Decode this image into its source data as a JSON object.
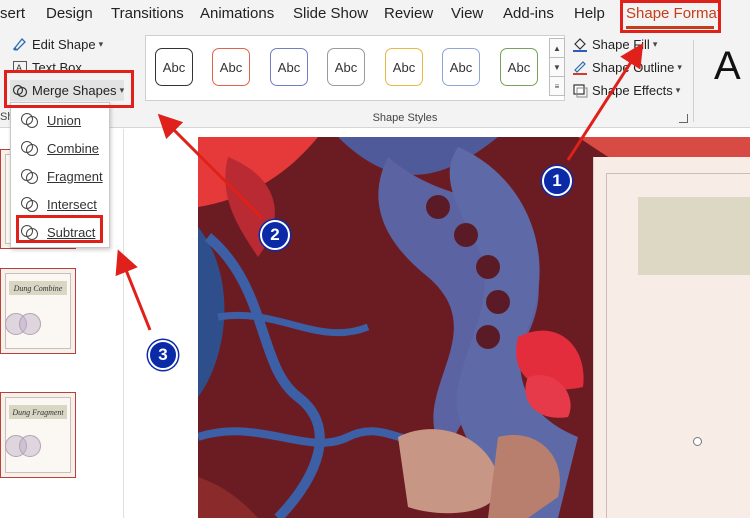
{
  "menu": {
    "tabs": [
      "sert",
      "Design",
      "Transitions",
      "Animations",
      "Slide Show",
      "Review",
      "View",
      "Add-ins",
      "Help"
    ],
    "active_tab": "Shape Format"
  },
  "ribbon": {
    "edit_shape": "Edit Shape",
    "text_box": "Text Box",
    "merge_shapes": "Merge Shapes",
    "insert_shapes_group_fragment": "Sha",
    "style_presets": [
      "Abc",
      "Abc",
      "Abc",
      "Abc",
      "Abc",
      "Abc",
      "Abc"
    ],
    "style_preset_border_colors": [
      "#333333",
      "#e0644a",
      "#6f7fbf",
      "#9a9a9a",
      "#e8b844",
      "#8ea7d8",
      "#7aa05a"
    ],
    "shape_fill": "Shape Fill",
    "shape_outline": "Shape Outline",
    "shape_effects": "Shape Effects",
    "shape_styles_label": "Shape Styles",
    "wordart_preview": "A"
  },
  "merge_menu": {
    "items": [
      "Union",
      "Combine",
      "Fragment",
      "Intersect",
      "Subtract"
    ]
  },
  "thumbnails": [
    {
      "title": "Dung Combine"
    },
    {
      "title": "Dung Fragment"
    }
  ],
  "annotations": {
    "badges": [
      "1",
      "2",
      "3"
    ],
    "accent_color": "#e0201a",
    "badge_color": "#0b2aa8"
  }
}
